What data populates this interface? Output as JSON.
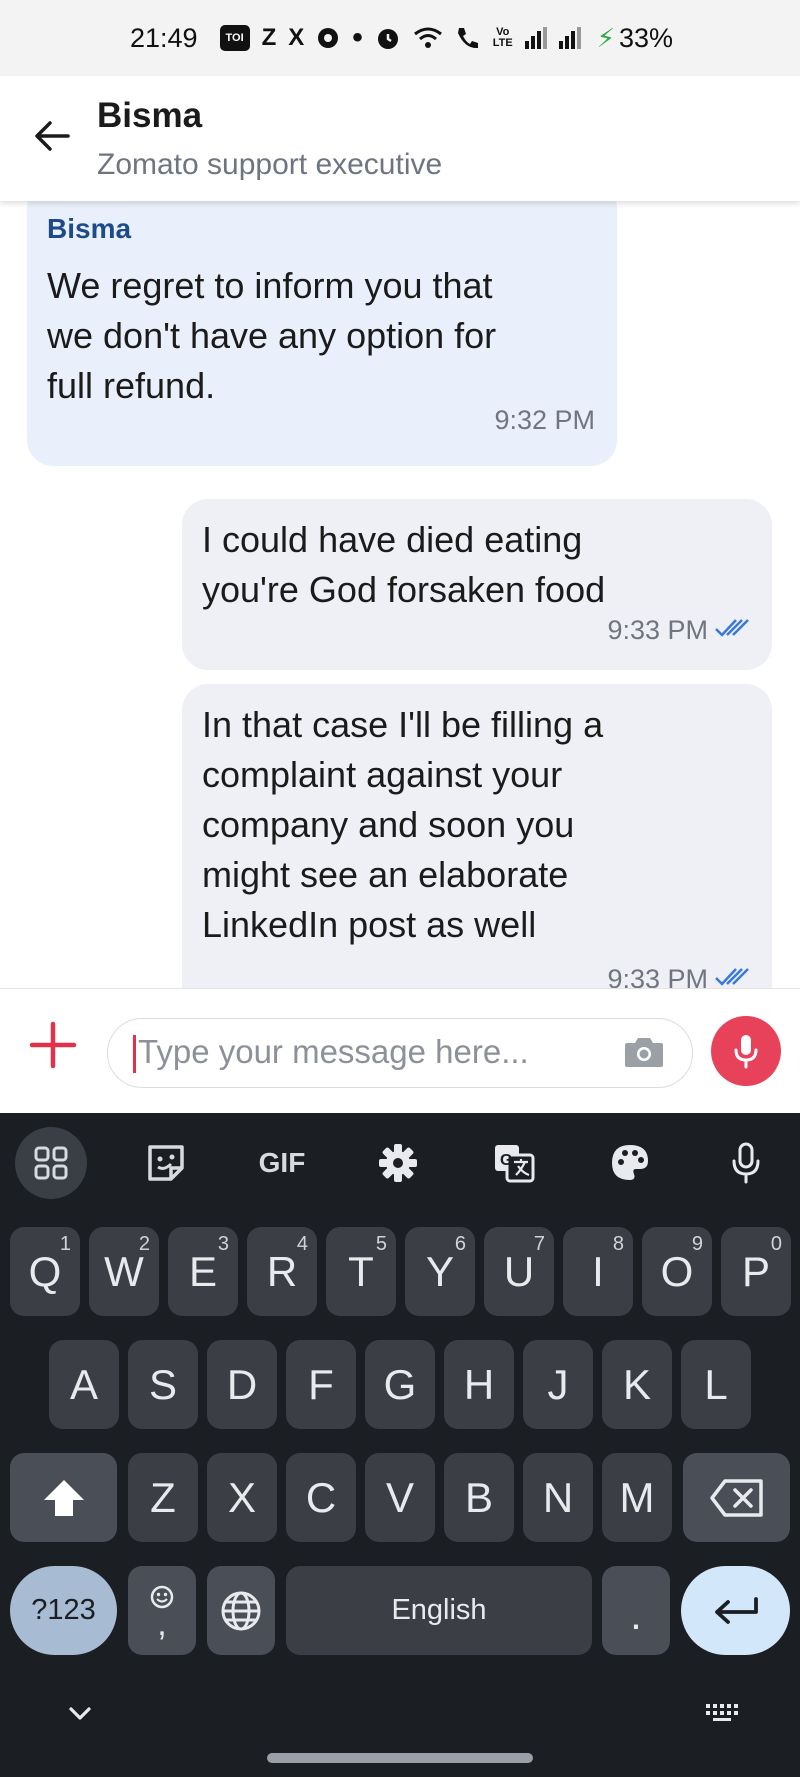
{
  "status_bar": {
    "time": "21:49",
    "toi_label": "TOI",
    "z_label": "Z",
    "x_label": "X",
    "volte_top": "Vo",
    "volte_bottom": "LTE",
    "battery": "33%",
    "icons": [
      "toi-app-icon",
      "zomato-z-icon",
      "x-app-icon",
      "chrome-icon",
      "dot-icon",
      "alarm-icon",
      "wifi-icon",
      "wifi-call-icon",
      "volte-icon",
      "signal-icon",
      "signal-icon",
      "charging-bolt-icon"
    ]
  },
  "header": {
    "name": "Bisma",
    "subtitle": "Zomato support executive"
  },
  "messages": [
    {
      "direction": "incoming",
      "sender": "Bisma",
      "lines": [
        "We regret to inform you that",
        "we don't have any option for",
        "full refund."
      ],
      "time": "9:32 PM"
    },
    {
      "direction": "outgoing",
      "lines": [
        "I could have died eating",
        "you're God forsaken food"
      ],
      "time": "9:33 PM",
      "status": "read"
    },
    {
      "direction": "outgoing",
      "lines": [
        "In that case I'll be filling a",
        "complaint against your",
        "company and soon you",
        "might see an elaborate",
        "LinkedIn post as well"
      ],
      "time": "9:33 PM",
      "status": "read"
    }
  ],
  "composer": {
    "placeholder": "Type your message here...",
    "value": ""
  },
  "keyboard": {
    "toolbar": {
      "gif_label": "GIF",
      "icons": [
        "apps-grid-icon",
        "sticker-icon",
        "gif-icon",
        "settings-gear-icon",
        "translate-icon",
        "palette-icon",
        "microphone-icon"
      ]
    },
    "row1": [
      {
        "key": "Q",
        "num": "1"
      },
      {
        "key": "W",
        "num": "2"
      },
      {
        "key": "E",
        "num": "3"
      },
      {
        "key": "R",
        "num": "4"
      },
      {
        "key": "T",
        "num": "5"
      },
      {
        "key": "Y",
        "num": "6"
      },
      {
        "key": "U",
        "num": "7"
      },
      {
        "key": "I",
        "num": "8"
      },
      {
        "key": "O",
        "num": "9"
      },
      {
        "key": "P",
        "num": "0"
      }
    ],
    "row2": [
      "A",
      "S",
      "D",
      "F",
      "G",
      "H",
      "J",
      "K",
      "L"
    ],
    "row3": [
      "Z",
      "X",
      "C",
      "V",
      "B",
      "N",
      "M"
    ],
    "symbols_label": "?123",
    "emoji_comma": ",",
    "space_label": "English",
    "period_label": ".",
    "colors": {
      "background": "#1b1e22",
      "key": "#3b3f45",
      "symbols_key": "#a7bcd2",
      "enter_key": "#d3e7fb"
    }
  },
  "colors": {
    "mic_button": "#e8425a",
    "sender_name": "#1c4a8a",
    "read_ticks": "#3b78d8",
    "incoming_bubble": "#eaf0fb",
    "outgoing_bubble": "#eef0f5"
  }
}
